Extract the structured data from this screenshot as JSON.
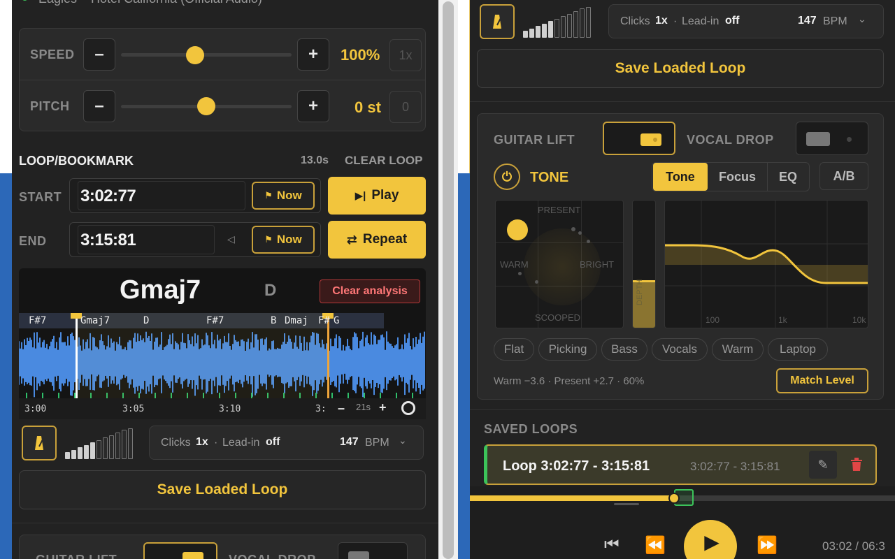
{
  "left": {
    "track_title": "Eagles – Hotel California (Official Audio)",
    "speed": {
      "label": "SPEED",
      "value": "100%",
      "reset": "1x",
      "minus": "–",
      "plus": "+",
      "level": 0.5
    },
    "pitch": {
      "label": "PITCH",
      "value": "0 st",
      "reset": "0",
      "minus": "–",
      "plus": "+",
      "level": 0.5
    },
    "loop": {
      "title": "LOOP/BOOKMARK",
      "duration": "13.0s",
      "clear": "CLEAR LOOP",
      "start_label": "START",
      "start_time": "3:02:77",
      "end_label": "END",
      "end_time": "3:15:81",
      "now_label": "Now",
      "play_label": "Play",
      "repeat_label": "Repeat"
    },
    "analysis": {
      "current_chord": "Gmaj7",
      "next_chord": "D",
      "clear_label": "Clear analysis",
      "chords": [
        "F#7",
        "Gmaj7",
        "D",
        "F#7",
        "B",
        "Dmaj",
        "F#",
        "G"
      ],
      "ticks": [
        "3:00",
        "3:05",
        "3:10",
        "3:"
      ],
      "zoom_minus": "–",
      "zoom_value": "21s",
      "zoom_plus": "+"
    },
    "metronome": {
      "clicks_label": "Clicks",
      "clicks_value": "1x",
      "leadin_label": "Lead-in",
      "leadin_value": "off",
      "bpm": "147",
      "bpm_unit": "BPM"
    },
    "save_label": "Save Loaded Loop",
    "guitar_lift": "GUITAR LIFT",
    "vocal_drop": "VOCAL DROP"
  },
  "right": {
    "metronome": {
      "clicks_label": "Clicks",
      "clicks_value": "1x",
      "leadin_label": "Lead-in",
      "leadin_value": "off",
      "bpm": "147",
      "bpm_unit": "BPM"
    },
    "save_label": "Save Loaded Loop",
    "guitar_lift": "GUITAR LIFT",
    "vocal_drop": "VOCAL DROP",
    "tone": {
      "label": "TONE",
      "tabs": [
        "Tone",
        "Focus",
        "EQ"
      ],
      "ab": "A/B",
      "pad_labels": {
        "top": "PRESENT",
        "left": "WARM",
        "right": "BRIGHT",
        "bottom": "SCOOPED"
      },
      "depth_label": "DEPTH",
      "depth_level": 0.6,
      "eq_labels": [
        "100",
        "1k",
        "10k"
      ],
      "presets": [
        "Flat",
        "Picking",
        "Bass",
        "Vocals",
        "Warm",
        "Laptop"
      ],
      "status": "Warm −3.6 · Present +2.7 · 60%",
      "match_level": "Match Level"
    },
    "saved": {
      "title": "SAVED LOOPS",
      "items": [
        {
          "name": "Loop 3:02:77 - 3:15:81",
          "range": "3:02:77 - 3:15:81"
        }
      ]
    },
    "transport": {
      "time": "03:02 / 06:3",
      "progress": 0.48
    }
  },
  "colors": {
    "accent": "#f2c53d",
    "panel": "#222222",
    "wave": "#4a8ae0",
    "danger": "#e04646"
  }
}
